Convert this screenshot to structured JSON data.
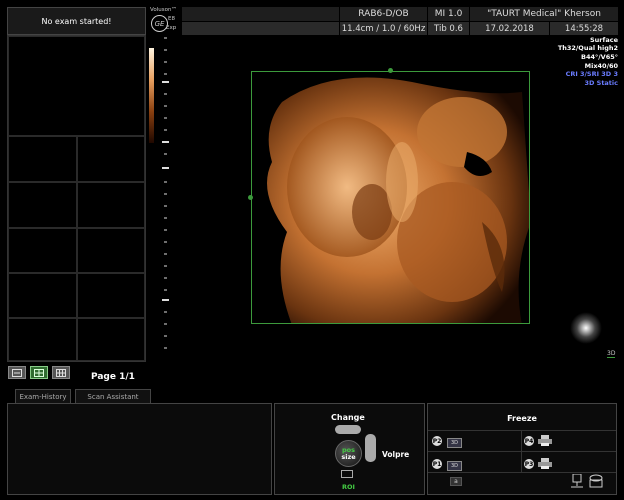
{
  "status": {
    "exam_message": "No exam started!"
  },
  "brand": {
    "line1": "Voluson™",
    "line2": "E8",
    "line3": "Exp"
  },
  "header": {
    "probe": "RAB6-D/OB",
    "mi": "MI 1.0",
    "institution": "\"TAURT Medical\" Kherson",
    "depth": "11.4cm / 1.0 / 60Hz",
    "tib": "Tib 0.6",
    "date": "17.02.2018",
    "time": "14:55:28"
  },
  "params": [
    "Surface",
    "Th32/Qual high2",
    "B44°/V65°",
    "Mix40/60"
  ],
  "params_blue": [
    "CRI 3/SRI 3D 3",
    "3D Static"
  ],
  "indicator_3d": "3D",
  "left": {
    "page": "Page 1/1"
  },
  "tabs": [
    "Exam-History",
    "Scan Assistant"
  ],
  "roi": {
    "change": "Change",
    "pos": "pos",
    "size": "size",
    "volpre": "Volpre",
    "roi": "ROI"
  },
  "freeze": {
    "title": "Freeze",
    "p2": "P2",
    "p4": "P4",
    "p1": "P1",
    "p3": "P3",
    "badge_p2": "3D",
    "badge_p1": "3D",
    "a_btn": "a"
  }
}
